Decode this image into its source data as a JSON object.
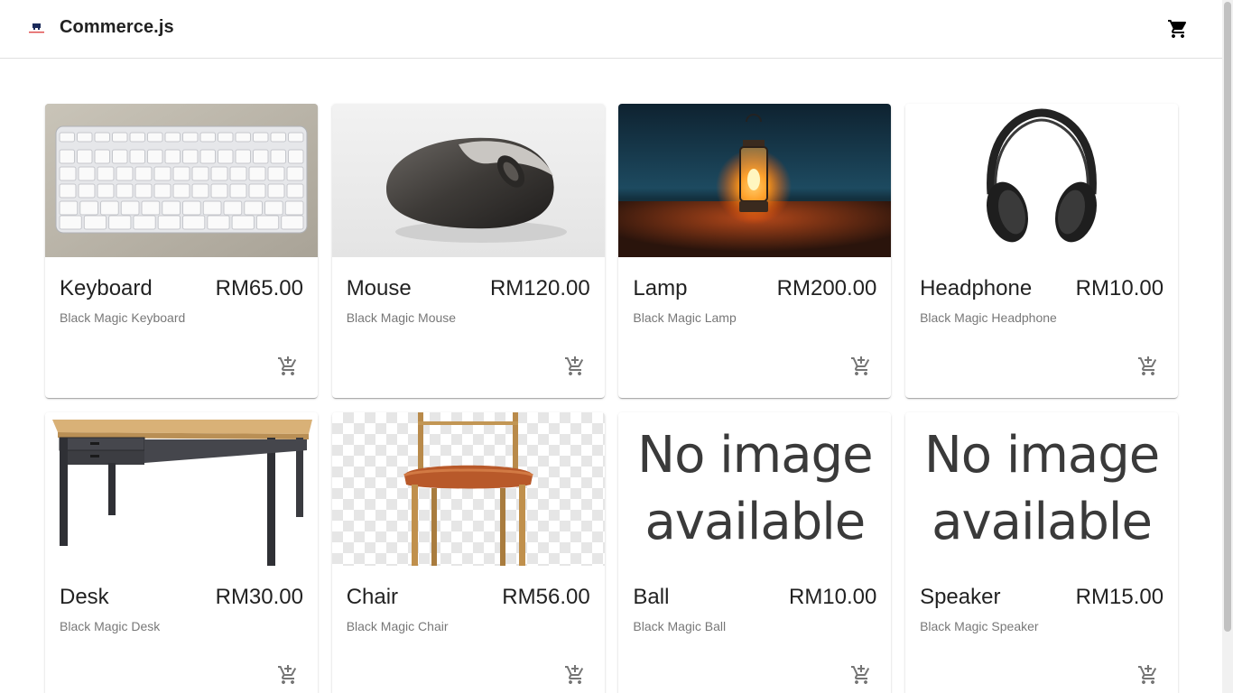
{
  "header": {
    "brand": "Commerce.js",
    "logo_icon": "commerce-logo-icon",
    "cart_icon": "shopping-cart-icon"
  },
  "products": [
    {
      "name": "Keyboard",
      "price": "RM65.00",
      "description": "Black Magic Keyboard",
      "image": "keyboard"
    },
    {
      "name": "Mouse",
      "price": "RM120.00",
      "description": "Black Magic Mouse",
      "image": "mouse"
    },
    {
      "name": "Lamp",
      "price": "RM200.00",
      "description": "Black Magic Lamp",
      "image": "lamp"
    },
    {
      "name": "Headphone",
      "price": "RM10.00",
      "description": "Black Magic Headphone",
      "image": "headphone"
    },
    {
      "name": "Desk",
      "price": "RM30.00",
      "description": "Black Magic Desk",
      "image": "desk"
    },
    {
      "name": "Chair",
      "price": "RM56.00",
      "description": "Black Magic Chair",
      "image": "chair"
    },
    {
      "name": "Ball",
      "price": "RM10.00",
      "description": "Black Magic Ball",
      "image": "none",
      "placeholder": "No image available"
    },
    {
      "name": "Speaker",
      "price": "RM15.00",
      "description": "Black Magic Speaker",
      "image": "none",
      "placeholder": "No image available"
    }
  ],
  "add_to_cart_icon": "add-shopping-cart-icon"
}
